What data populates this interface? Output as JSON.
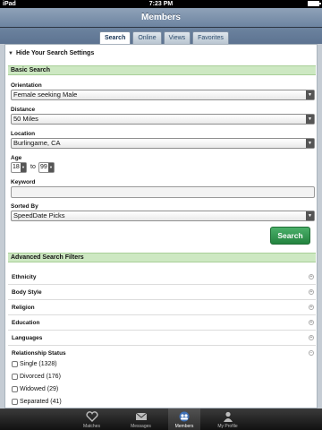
{
  "status_bar": {
    "carrier": "iPad",
    "time": "7:23 PM"
  },
  "nav": {
    "title": "Members"
  },
  "tabs": [
    {
      "label": "Search",
      "active": true
    },
    {
      "label": "Online"
    },
    {
      "label": "Views"
    },
    {
      "label": "Favorites"
    }
  ],
  "settings_toggle": "Hide Your Search Settings",
  "basic": {
    "header": "Basic Search",
    "orientation_label": "Orientation",
    "orientation_value": "Female seeking Male",
    "distance_label": "Distance",
    "distance_value": "50 Miles",
    "location_label": "Location",
    "location_value": "Burlingame, CA",
    "age_label": "Age",
    "age_min": "18",
    "age_to": "to",
    "age_max": "99",
    "keyword_label": "Keyword",
    "sorted_label": "Sorted By",
    "sorted_value": "SpeedDate Picks",
    "search_button": "Search"
  },
  "advanced": {
    "header": "Advanced Search Filters",
    "filters": [
      "Ethnicity",
      "Body Style",
      "Religion",
      "Education",
      "Languages"
    ],
    "relationship_label": "Relationship Status",
    "options": [
      "Single (1328)",
      "Divorced (176)",
      "Widowed (29)",
      "Separated (41)"
    ]
  },
  "bottom_tabs": [
    {
      "label": "Matches",
      "icon": "heart-icon"
    },
    {
      "label": "Messages",
      "icon": "envelope-icon"
    },
    {
      "label": "Members",
      "icon": "members-icon",
      "active": true
    },
    {
      "label": "My Profile",
      "icon": "person-icon"
    }
  ],
  "colors": {
    "accent_green": "#2f9a50",
    "section_green": "#cde8c2",
    "nav_blue": "#7b90aa"
  }
}
